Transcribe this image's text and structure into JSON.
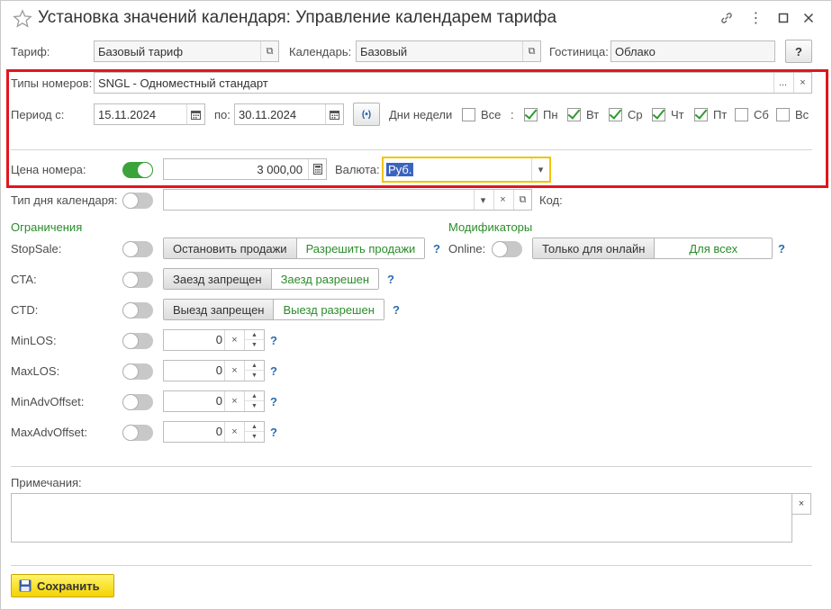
{
  "title": "Установка значений календаря: Управление календарем тарифа",
  "icons": {
    "star": "star-icon",
    "link": "link-icon",
    "more": "more-icon",
    "maximize": "maximize-icon",
    "close": "close-icon"
  },
  "header": {
    "tariff_label": "Тариф:",
    "tariff_value": "Базовый тариф",
    "calendar_label": "Календарь:",
    "calendar_value": "Базовый",
    "hotel_label": "Гостиница:",
    "hotel_value": "Облако",
    "help_label": "?"
  },
  "room_types": {
    "label": "Типы номеров:",
    "value": "SNGL - Одноместный стандарт",
    "more_label": "...",
    "clear_label": "×"
  },
  "period": {
    "from_label": "Период с:",
    "from_value": "15.11.2024",
    "to_label": "по:",
    "to_value": "30.11.2024",
    "weekdays_label": "Дни недели",
    "all_label": "Все",
    "all_checked": false,
    "colon": ":",
    "days": [
      {
        "label": "Пн",
        "checked": true
      },
      {
        "label": "Вт",
        "checked": true
      },
      {
        "label": "Ср",
        "checked": true
      },
      {
        "label": "Чт",
        "checked": true
      },
      {
        "label": "Пт",
        "checked": true
      },
      {
        "label": "Сб",
        "checked": false
      },
      {
        "label": "Вс",
        "checked": false
      }
    ]
  },
  "price": {
    "label": "Цена номера:",
    "toggle_on": true,
    "value": "3 000,00",
    "currency_label": "Валюта:",
    "currency_value": "Руб."
  },
  "day_type": {
    "label": "Тип дня календаря:",
    "toggle_on": false,
    "value": "",
    "code_label": "Код:"
  },
  "restrictions": {
    "title": "Ограничения",
    "stopsale": {
      "label": "StopSale:",
      "btn_off": "Остановить продажи",
      "btn_on": "Разрешить продажи"
    },
    "cta": {
      "label": "CTA:",
      "btn_off": "Заезд запрещен",
      "btn_on": "Заезд разрешен"
    },
    "ctd": {
      "label": "CTD:",
      "btn_off": "Выезд запрещен",
      "btn_on": "Выезд разрешен"
    },
    "numeric": [
      {
        "label": "MinLOS:",
        "value": "0"
      },
      {
        "label": "MaxLOS:",
        "value": "0"
      },
      {
        "label": "MinAdvOffset:",
        "value": "0"
      },
      {
        "label": "MaxAdvOffset:",
        "value": "0"
      }
    ],
    "help": "?"
  },
  "modifiers": {
    "title": "Модификаторы",
    "online_label": "Online:",
    "btn_online": "Только для онлайн",
    "btn_all": "Для всех",
    "help": "?"
  },
  "notes": {
    "label": "Примечания:",
    "value": "",
    "clear_label": "×"
  },
  "save_label": "Сохранить",
  "colors": {
    "accent_green": "#3aa33a",
    "highlight_red": "#e0161e",
    "save_yellow": "#f4d300",
    "link_blue": "#2b6cb0"
  }
}
